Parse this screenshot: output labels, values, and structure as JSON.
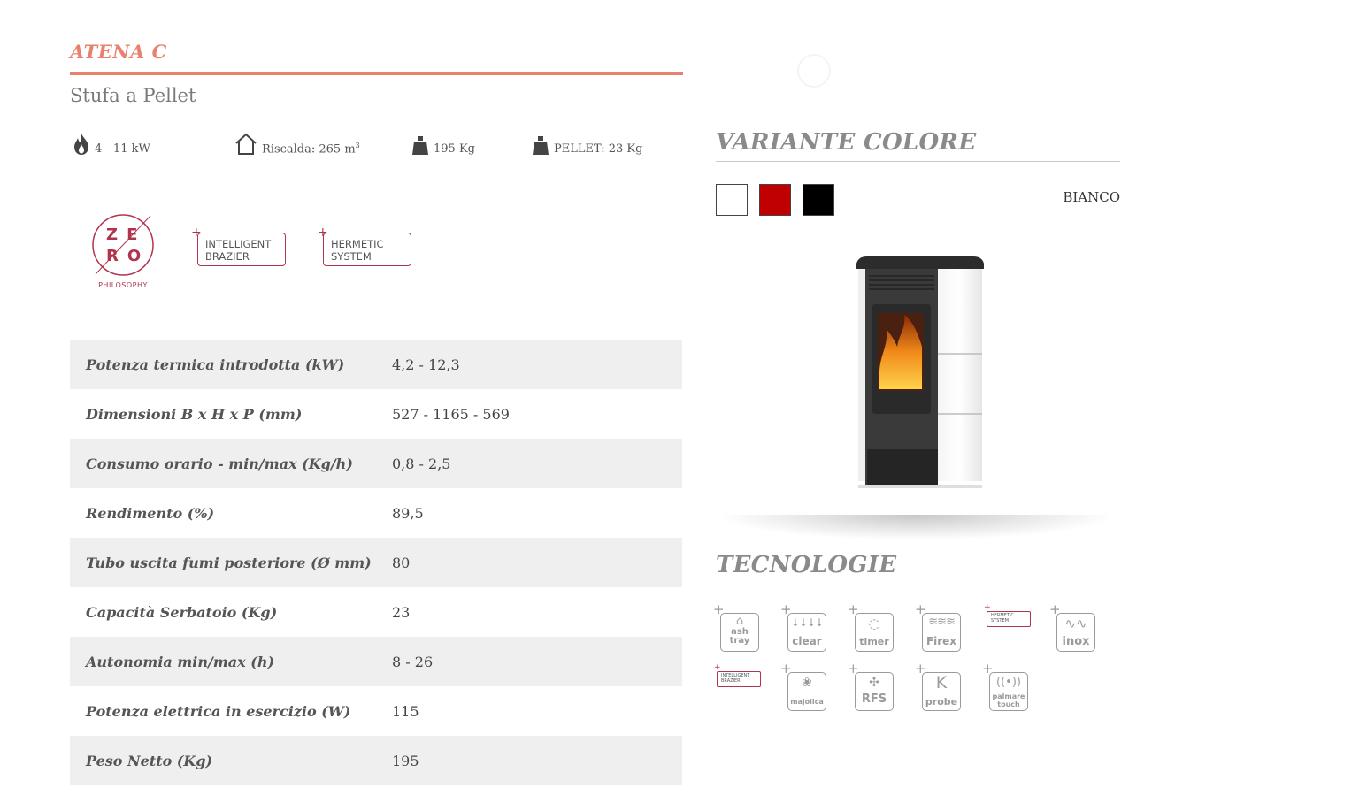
{
  "product": {
    "name": "ATENA C",
    "subtitle": "Stufa a Pellet"
  },
  "quick_specs": [
    {
      "icon": "flame-icon",
      "text": "4 - 11 kW"
    },
    {
      "icon": "house-icon",
      "text": "Riscalda: 265 m",
      "sup": "3"
    },
    {
      "icon": "weight-icon",
      "text": "195 Kg"
    },
    {
      "icon": "weight-icon",
      "text": "PELLET: 23 Kg"
    }
  ],
  "badges": {
    "zero": {
      "letters": [
        "Z",
        "E",
        "R",
        "O"
      ],
      "caption": "PHILOSOPHY"
    },
    "intelligent_brazier": [
      "INTELLIGENT",
      "BRAZIER"
    ],
    "hermetic_system": [
      "HERMETIC",
      "SYSTEM"
    ]
  },
  "spec_table": [
    {
      "label": "Potenza termica introdotta (kW)",
      "value": "4,2 - 12,3"
    },
    {
      "label": "Dimensioni B x H x P (mm)",
      "value": "527 - 1165 - 569"
    },
    {
      "label": "Consumo orario - min/max (Kg/h)",
      "value": "0,8 - 2,5"
    },
    {
      "label": "Rendimento (%)",
      "value": "89,5"
    },
    {
      "label": "Tubo uscita fumi posteriore (Ø mm)",
      "value": "80"
    },
    {
      "label": "Capacità Serbatoio (Kg)",
      "value": "23"
    },
    {
      "label": "Autonomia min/max (h)",
      "value": "8 - 26"
    },
    {
      "label": "Potenza elettrica in esercizio (W)",
      "value": "115"
    },
    {
      "label": "Peso Netto (Kg)",
      "value": "195"
    }
  ],
  "variant_section": {
    "title": "VARIANTE COLORE",
    "selected_color": "BIANCO",
    "swatches": [
      {
        "name": "bianco",
        "color": "#ffffff"
      },
      {
        "name": "rosso",
        "color": "#c00000"
      },
      {
        "name": "nero",
        "color": "#000000"
      }
    ]
  },
  "tech_section": {
    "title": "TECNOLOGIE",
    "items": [
      {
        "icon": "ash-tray-icon",
        "label": "ash tray"
      },
      {
        "icon": "clear-icon",
        "label": "clear"
      },
      {
        "icon": "timer-icon",
        "label": "timer"
      },
      {
        "icon": "firex-icon",
        "label": "Firex"
      },
      {
        "icon": "hermetic-system-icon",
        "label": "HERMETIC SYSTEM"
      },
      {
        "icon": "inox-icon",
        "label": "inox"
      },
      {
        "icon": "intelligent-brazier-icon",
        "label": "INTELLIGENT BRAZIER"
      },
      {
        "icon": "majolica-icon",
        "label": "majolica"
      },
      {
        "icon": "rfs-icon",
        "label": "RFS"
      },
      {
        "icon": "probe-icon",
        "label": "probe",
        "glyph": "K"
      },
      {
        "icon": "palmare-touch-icon",
        "label": "palmare touch"
      }
    ]
  },
  "colors": {
    "accent": "#e8826f",
    "badge": "#b0344e",
    "table_stripe": "#efefef",
    "section_title": "#8a8a8a"
  }
}
